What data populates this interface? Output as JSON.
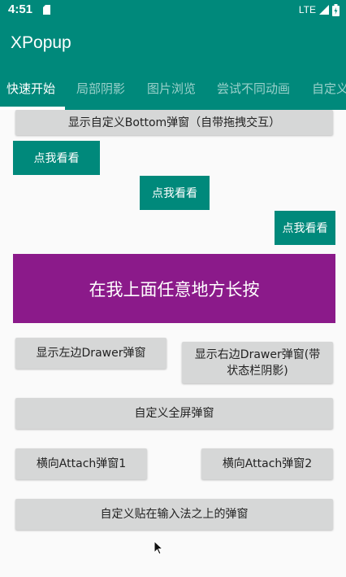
{
  "status_bar": {
    "time": "4:51",
    "network": "LTE"
  },
  "app_bar": {
    "title": "XPopup"
  },
  "tabs": [
    {
      "label": "快速开始",
      "active": true
    },
    {
      "label": "局部阴影",
      "active": false
    },
    {
      "label": "图片浏览",
      "active": false
    },
    {
      "label": "尝试不同动画",
      "active": false
    },
    {
      "label": "自定义",
      "active": false
    }
  ],
  "buttons": {
    "bottom_popup": "显示自定义Bottom弹窗（自带拖拽交互）",
    "look_left": "点我看看",
    "look_center": "点我看看",
    "look_right": "点我看看",
    "long_press_area": "在我上面任意地方长按",
    "left_drawer": "显示左边Drawer弹窗",
    "right_drawer": "显示右边Drawer弹窗(带状态栏阴影)",
    "fullscreen": "自定义全屏弹窗",
    "attach_1": "横向Attach弹窗1",
    "attach_2": "横向Attach弹窗2",
    "input_popup": "自定义贴在输入法之上的弹窗"
  },
  "colors": {
    "primary": "#00897B",
    "long_press_bg": "#8B1A8A",
    "button_bg": "#D6D7D7",
    "content_bg": "#FAFAFA"
  }
}
